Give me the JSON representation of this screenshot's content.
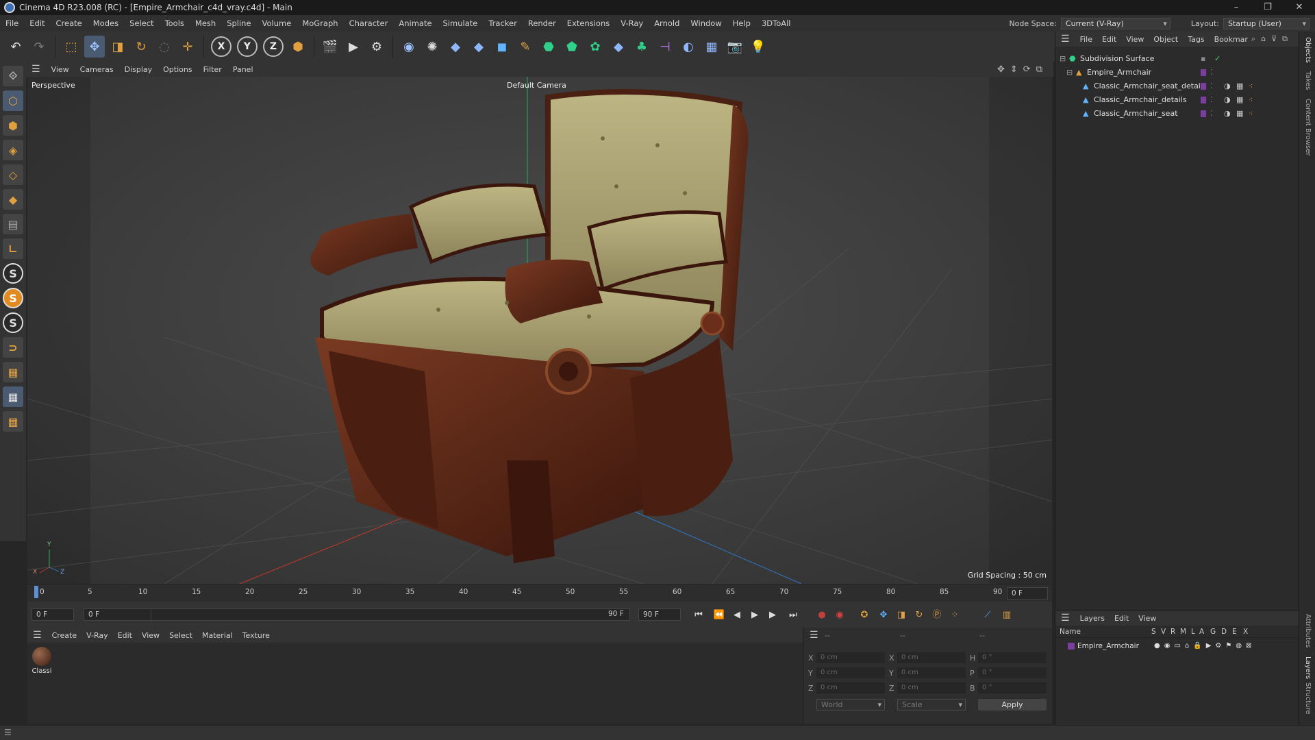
{
  "window": {
    "title": "Cinema 4D R23.008 (RC) - [Empire_Armchair_c4d_vray.c4d] - Main",
    "controls": [
      "–",
      "❐",
      "✕"
    ]
  },
  "menubar": {
    "items": [
      "File",
      "Edit",
      "Create",
      "Modes",
      "Select",
      "Tools",
      "Mesh",
      "Spline",
      "Volume",
      "MoGraph",
      "Character",
      "Animate",
      "Simulate",
      "Tracker",
      "Render",
      "Extensions",
      "V-Ray",
      "Arnold",
      "Window",
      "Help",
      "3DToAll"
    ],
    "node_space_label": "Node Space:",
    "node_space_value": "Current (V-Ray)",
    "layout_label": "Layout:",
    "layout_value": "Startup (User)"
  },
  "toolbar": {
    "axis_x": "X",
    "axis_y": "Y",
    "axis_z": "Z"
  },
  "viewport_menu": {
    "items": [
      "View",
      "Cameras",
      "Display",
      "Options",
      "Filter",
      "Panel"
    ]
  },
  "viewport": {
    "name": "Perspective",
    "camera": "Default Camera",
    "grid_spacing": "Grid Spacing : 50 cm",
    "axis_labels": {
      "x": "X",
      "y": "Y",
      "z": "Z"
    }
  },
  "timeline": {
    "ticks": [
      "0",
      "5",
      "10",
      "15",
      "20",
      "25",
      "30",
      "35",
      "40",
      "45",
      "50",
      "55",
      "60",
      "65",
      "70",
      "75",
      "80",
      "85",
      "90"
    ],
    "current_frame": "0 F"
  },
  "transport": {
    "start_field": "0 F",
    "range_start": "0 F",
    "range_end": "90 F",
    "end_field": "90 F"
  },
  "material_panel": {
    "menu": [
      "Create",
      "V-Ray",
      "Edit",
      "View",
      "Select",
      "Material",
      "Texture"
    ],
    "materials": [
      {
        "name": "Classi"
      }
    ]
  },
  "attributes": {
    "header_dashes": [
      "--",
      "--",
      "--"
    ],
    "rows": [
      {
        "a_label": "X",
        "a_value": "0 cm",
        "b_label": "X",
        "b_value": "0 cm",
        "c_label": "H",
        "c_value": "0 °"
      },
      {
        "a_label": "Y",
        "a_value": "0 cm",
        "b_label": "Y",
        "b_value": "0 cm",
        "c_label": "P",
        "c_value": "0 °"
      },
      {
        "a_label": "Z",
        "a_value": "0 cm",
        "b_label": "Z",
        "b_value": "0 cm",
        "c_label": "B",
        "c_value": "0 °"
      }
    ],
    "coord_system": "World",
    "mode": "Scale",
    "apply_label": "Apply"
  },
  "object_manager": {
    "menu": [
      "File",
      "Edit",
      "View",
      "Object",
      "Tags",
      "Bookmar"
    ],
    "objects": [
      {
        "name": "Subdivision Surface",
        "level": 0
      },
      {
        "name": "Empire_Armchair",
        "level": 1
      },
      {
        "name": "Classic_Armchair_seat_details",
        "level": 2
      },
      {
        "name": "Classic_Armchair_details",
        "level": 2
      },
      {
        "name": "Classic_Armchair_seat",
        "level": 2
      }
    ]
  },
  "layer_manager": {
    "menu": [
      "Layers",
      "Edit",
      "View"
    ],
    "columns": [
      "Name",
      "S",
      "V",
      "R",
      "M",
      "L",
      "A",
      "G",
      "D",
      "E",
      "X"
    ],
    "layers": [
      {
        "name": "Empire_Armchair",
        "color": "#7a3e9e"
      }
    ]
  },
  "side_tabs": [
    "Objects",
    "Takes",
    "Content Browser",
    "Attributes",
    "Layers",
    "Structure"
  ],
  "colors": {
    "accent": "#4a5a70",
    "axis_x": "#c0392b",
    "axis_y": "#27ae60",
    "axis_z": "#2f6fb5",
    "layer_purple": "#7a3e9e",
    "wood": "#5a2a18",
    "cushion": "#a8a070"
  }
}
